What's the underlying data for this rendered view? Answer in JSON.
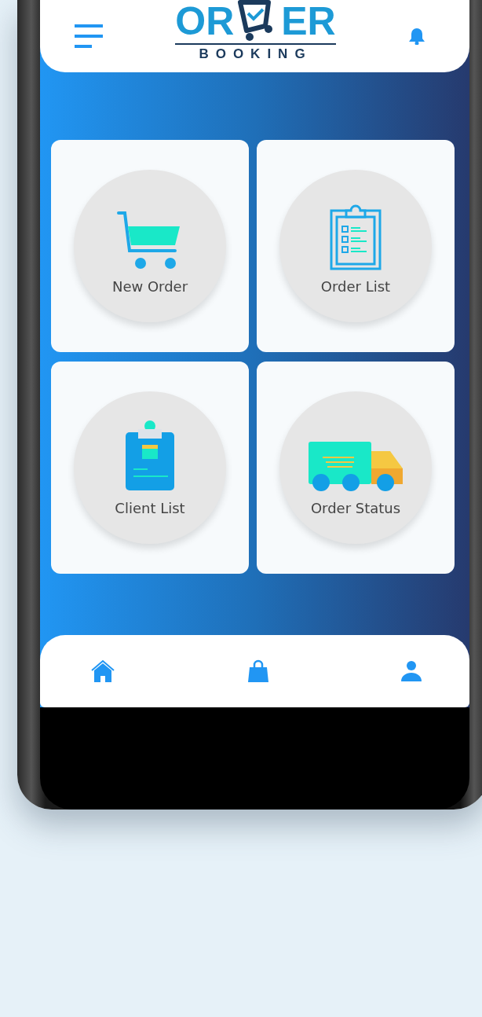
{
  "header": {
    "logo": {
      "left": "OR",
      "right": "ER",
      "subtitle": "BOOKING"
    }
  },
  "tiles": [
    {
      "kind": "cart",
      "label": "New Order"
    },
    {
      "kind": "clipboard",
      "label": "Order List"
    },
    {
      "kind": "client",
      "label": "Client List"
    },
    {
      "kind": "truck",
      "label": "Order Status"
    }
  ],
  "nav": [
    {
      "kind": "home"
    },
    {
      "kind": "bag"
    },
    {
      "kind": "user"
    }
  ]
}
